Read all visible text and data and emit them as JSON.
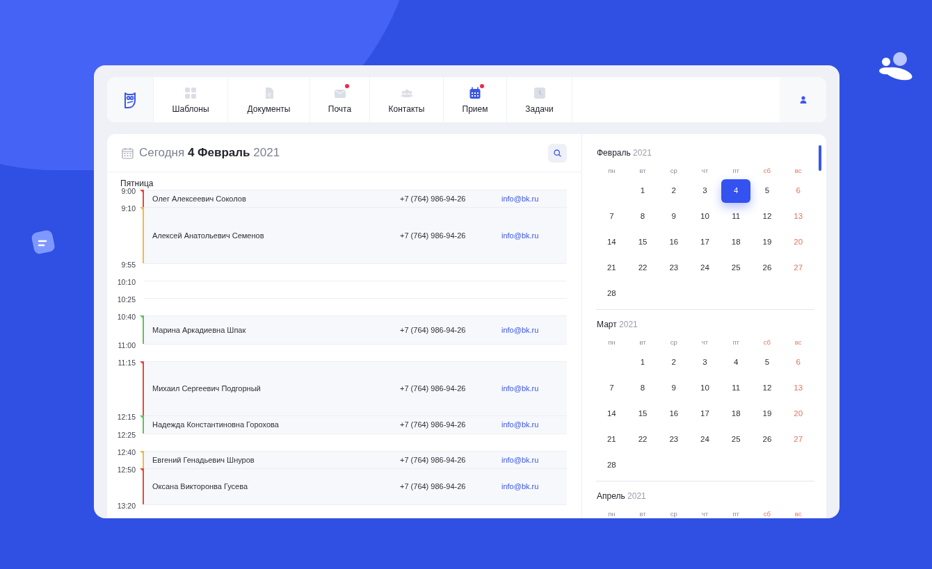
{
  "nav": {
    "tabs": [
      {
        "kind": "templates",
        "label": "Шаблоны",
        "badge": false,
        "selected": false
      },
      {
        "kind": "documents",
        "label": "Документы",
        "badge": false,
        "selected": false
      },
      {
        "kind": "mail",
        "label": "Почта",
        "badge": true,
        "selected": false
      },
      {
        "kind": "contacts",
        "label": "Контакты",
        "badge": false,
        "selected": false
      },
      {
        "kind": "calendar",
        "label": "Прием",
        "badge": true,
        "selected": true
      },
      {
        "kind": "tasks",
        "label": "Задачи",
        "badge": false,
        "selected": false
      }
    ]
  },
  "schedule": {
    "today_label": "Сегодня",
    "date": "4 Февраль",
    "year": "2021",
    "weekday": "Пятница",
    "slots": [
      {
        "time": "9:00",
        "color": "#e8483b",
        "name": "Олег Алексеевич Соколов",
        "phone": "+7 (764) 986-94-26",
        "email": "info@bk.ru"
      },
      {
        "time": "9:10",
        "color": "#f2b84b",
        "name": "Алексей Анатольевич Семенов",
        "phone": "+7 (764) 986-94-26",
        "email": "info@bk.ru"
      },
      {
        "time": "9:55"
      },
      {
        "time": "10:10"
      },
      {
        "time": "10:25"
      },
      {
        "time": "10:40",
        "color": "#5cc45a",
        "name": "Марина Аркадиевна Шпак",
        "phone": "+7 (764) 986-94-26",
        "email": "info@bk.ru"
      },
      {
        "time": "11:00"
      },
      {
        "time": "11:15",
        "color": "#e8483b",
        "name": "Михаил Сергеевич Подгорный",
        "phone": "+7 (764) 986-94-26",
        "email": "info@bk.ru"
      },
      {
        "time": "12:15",
        "color": "#5cc45a",
        "name": "Надежда Константиновна Горохова",
        "phone": "+7 (764) 986-94-26",
        "email": "info@bk.ru"
      },
      {
        "time": "12:25"
      },
      {
        "time": "12:40",
        "color": "#f2b84b",
        "name": "Евгений Генадьевич Шнуров",
        "phone": "+7 (764) 986-94-26",
        "email": "info@bk.ru"
      },
      {
        "time": "12:50",
        "color": "#e8483b",
        "name": "Оксана Викторонва Гусева",
        "phone": "+7 (764) 986-94-26",
        "email": "info@bk.ru"
      },
      {
        "time": "13:20"
      }
    ]
  },
  "months": [
    {
      "name": "Февраль",
      "year": "2021",
      "weekdays": [
        {
          "label": "пн",
          "weekend": false
        },
        {
          "label": "вт",
          "weekend": false
        },
        {
          "label": "ср",
          "weekend": false
        },
        {
          "label": "чт",
          "weekend": false
        },
        {
          "label": "пт",
          "weekend": false
        },
        {
          "label": "сб",
          "weekend": true
        },
        {
          "label": "вс",
          "weekend": true
        }
      ],
      "days": [
        {
          "kind": "blank"
        },
        {
          "kind": "day",
          "day": "1",
          "weekend": false,
          "selected": false
        },
        {
          "kind": "day",
          "day": "2",
          "weekend": false,
          "selected": false
        },
        {
          "kind": "day",
          "day": "3",
          "weekend": false,
          "selected": false
        },
        {
          "kind": "day",
          "day": "4",
          "weekend": false,
          "selected": true
        },
        {
          "kind": "day",
          "day": "5",
          "weekend": false,
          "selected": false
        },
        {
          "kind": "day",
          "day": "6",
          "weekend": true,
          "selected": false
        },
        {
          "kind": "day",
          "day": "7",
          "weekend": false,
          "selected": false
        },
        {
          "kind": "day",
          "day": "8",
          "weekend": false,
          "selected": false
        },
        {
          "kind": "day",
          "day": "9",
          "weekend": false,
          "selected": false
        },
        {
          "kind": "day",
          "day": "10",
          "weekend": false,
          "selected": false
        },
        {
          "kind": "day",
          "day": "11",
          "weekend": false,
          "selected": false
        },
        {
          "kind": "day",
          "day": "12",
          "weekend": false,
          "selected": false
        },
        {
          "kind": "day",
          "day": "13",
          "weekend": true,
          "selected": false
        },
        {
          "kind": "day",
          "day": "14",
          "weekend": false,
          "selected": false
        },
        {
          "kind": "day",
          "day": "15",
          "weekend": false,
          "selected": false
        },
        {
          "kind": "day",
          "day": "16",
          "weekend": false,
          "selected": false
        },
        {
          "kind": "day",
          "day": "17",
          "weekend": false,
          "selected": false
        },
        {
          "kind": "day",
          "day": "18",
          "weekend": false,
          "selected": false
        },
        {
          "kind": "day",
          "day": "19",
          "weekend": false,
          "selected": false
        },
        {
          "kind": "day",
          "day": "20",
          "weekend": true,
          "selected": false
        },
        {
          "kind": "day",
          "day": "21",
          "weekend": false,
          "selected": false
        },
        {
          "kind": "day",
          "day": "22",
          "weekend": false,
          "selected": false
        },
        {
          "kind": "day",
          "day": "23",
          "weekend": false,
          "selected": false
        },
        {
          "kind": "day",
          "day": "24",
          "weekend": false,
          "selected": false
        },
        {
          "kind": "day",
          "day": "25",
          "weekend": false,
          "selected": false
        },
        {
          "kind": "day",
          "day": "26",
          "weekend": false,
          "selected": false
        },
        {
          "kind": "day",
          "day": "27",
          "weekend": true,
          "selected": false
        },
        {
          "kind": "day",
          "day": "28",
          "weekend": false,
          "selected": false
        }
      ]
    },
    {
      "name": "Март",
      "year": "2021",
      "weekdays": [
        {
          "label": "пн",
          "weekend": false
        },
        {
          "label": "вт",
          "weekend": false
        },
        {
          "label": "ср",
          "weekend": false
        },
        {
          "label": "чт",
          "weekend": false
        },
        {
          "label": "пт",
          "weekend": false
        },
        {
          "label": "сб",
          "weekend": true
        },
        {
          "label": "вс",
          "weekend": true
        }
      ],
      "days": [
        {
          "kind": "blank"
        },
        {
          "kind": "day",
          "day": "1",
          "weekend": false,
          "selected": false
        },
        {
          "kind": "day",
          "day": "2",
          "weekend": false,
          "selected": false
        },
        {
          "kind": "day",
          "day": "3",
          "weekend": false,
          "selected": false
        },
        {
          "kind": "day",
          "day": "4",
          "weekend": false,
          "selected": false
        },
        {
          "kind": "day",
          "day": "5",
          "weekend": false,
          "selected": false
        },
        {
          "kind": "day",
          "day": "6",
          "weekend": true,
          "selected": false
        },
        {
          "kind": "day",
          "day": "7",
          "weekend": false,
          "selected": false
        },
        {
          "kind": "day",
          "day": "8",
          "weekend": false,
          "selected": false
        },
        {
          "kind": "day",
          "day": "9",
          "weekend": false,
          "selected": false
        },
        {
          "kind": "day",
          "day": "10",
          "weekend": false,
          "selected": false
        },
        {
          "kind": "day",
          "day": "11",
          "weekend": false,
          "selected": false
        },
        {
          "kind": "day",
          "day": "12",
          "weekend": false,
          "selected": false
        },
        {
          "kind": "day",
          "day": "13",
          "weekend": true,
          "selected": false
        },
        {
          "kind": "day",
          "day": "14",
          "weekend": false,
          "selected": false
        },
        {
          "kind": "day",
          "day": "15",
          "weekend": false,
          "selected": false
        },
        {
          "kind": "day",
          "day": "16",
          "weekend": false,
          "selected": false
        },
        {
          "kind": "day",
          "day": "17",
          "weekend": false,
          "selected": false
        },
        {
          "kind": "day",
          "day": "18",
          "weekend": false,
          "selected": false
        },
        {
          "kind": "day",
          "day": "19",
          "weekend": false,
          "selected": false
        },
        {
          "kind": "day",
          "day": "20",
          "weekend": true,
          "selected": false
        },
        {
          "kind": "day",
          "day": "21",
          "weekend": false,
          "selected": false
        },
        {
          "kind": "day",
          "day": "22",
          "weekend": false,
          "selected": false
        },
        {
          "kind": "day",
          "day": "23",
          "weekend": false,
          "selected": false
        },
        {
          "kind": "day",
          "day": "24",
          "weekend": false,
          "selected": false
        },
        {
          "kind": "day",
          "day": "25",
          "weekend": false,
          "selected": false
        },
        {
          "kind": "day",
          "day": "26",
          "weekend": false,
          "selected": false
        },
        {
          "kind": "day",
          "day": "27",
          "weekend": true,
          "selected": false
        },
        {
          "kind": "day",
          "day": "28",
          "weekend": false,
          "selected": false
        }
      ]
    },
    {
      "name": "Апрель",
      "year": "2021",
      "weekdays": [
        {
          "label": "пн",
          "weekend": false
        },
        {
          "label": "вт",
          "weekend": false
        },
        {
          "label": "ср",
          "weekend": false
        },
        {
          "label": "чт",
          "weekend": false
        },
        {
          "label": "пт",
          "weekend": false
        },
        {
          "label": "сб",
          "weekend": true
        },
        {
          "label": "вс",
          "weekend": true
        }
      ]
    }
  ]
}
